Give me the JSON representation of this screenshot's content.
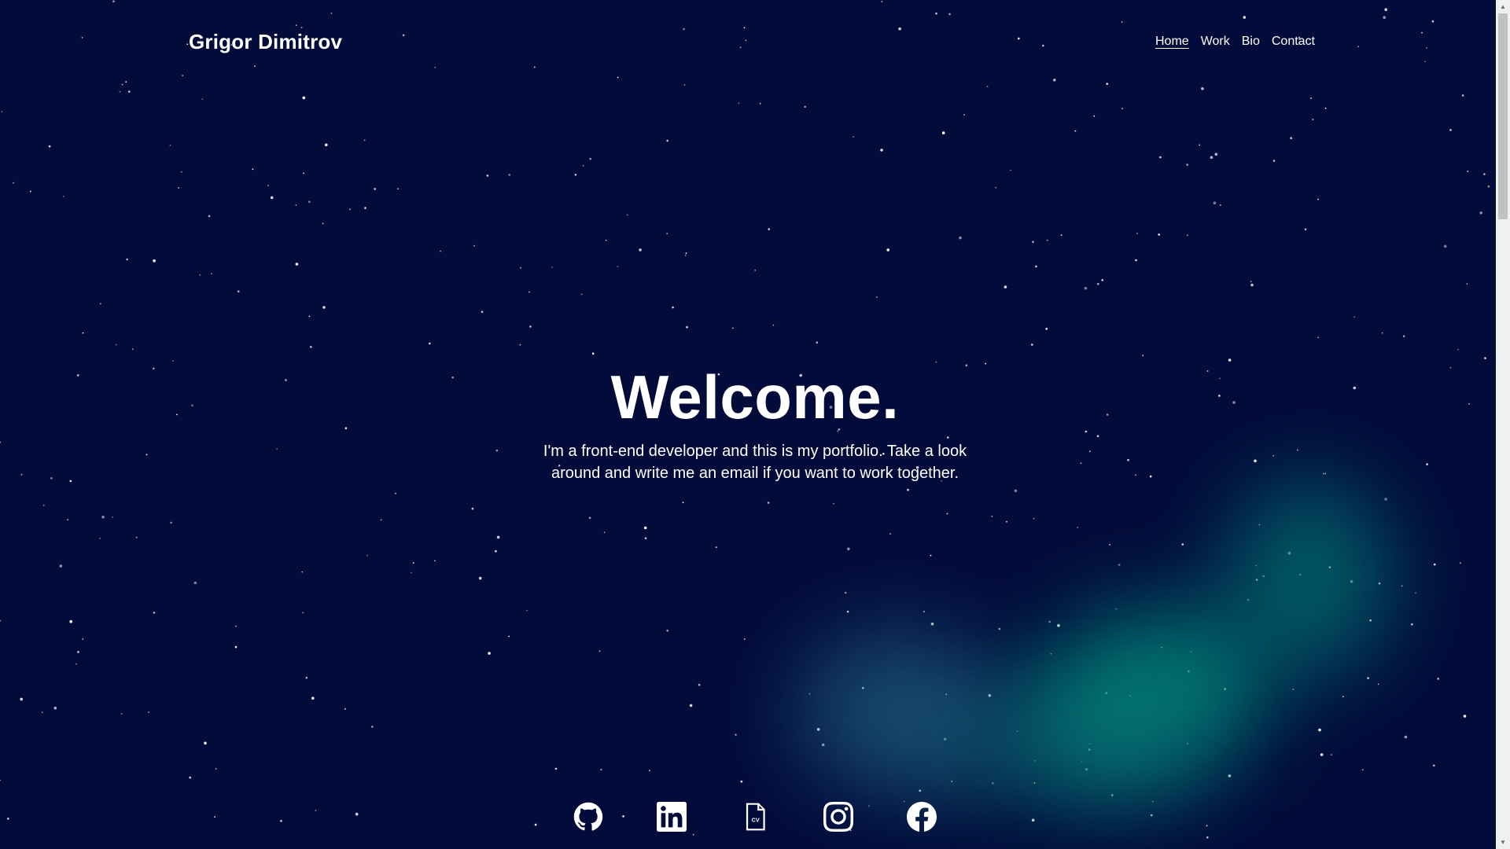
{
  "header": {
    "brand": "Grigor Dimitrov",
    "nav": [
      {
        "label": "Home",
        "active": true
      },
      {
        "label": "Work",
        "active": false
      },
      {
        "label": "Bio",
        "active": false
      },
      {
        "label": "Contact",
        "active": false
      }
    ]
  },
  "hero": {
    "title": "Welcome.",
    "subtitle": "I'm a front-end developer and this is my portfolio. Take a look around and write me an email if you want to work together."
  },
  "social": [
    {
      "icon": "github-icon"
    },
    {
      "icon": "linkedin-icon"
    },
    {
      "icon": "cv-document-icon",
      "label": "CV"
    },
    {
      "icon": "instagram-icon"
    },
    {
      "icon": "facebook-icon"
    }
  ],
  "colors": {
    "background": "#020b3a",
    "text": "#ffffff",
    "aurora_teal": "#009688",
    "aurora_blue": "#287896"
  },
  "scrollbar": {
    "up_glyph": "▲",
    "down_glyph": "▼"
  }
}
